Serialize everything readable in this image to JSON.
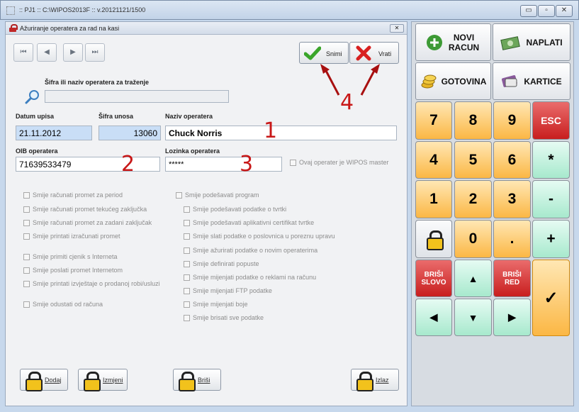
{
  "window": {
    "title": ":: PJ1 :: C:\\WIPOS2013F :: v.20121121/1500",
    "minimize": "▭",
    "maximize": "▫",
    "close": "✕"
  },
  "dialog": {
    "title": "Ažuriranje operatera za rad na kasi",
    "close": "✕"
  },
  "nav": {
    "first": "⏮",
    "prev": "◀",
    "next": "▶",
    "last": "⏭"
  },
  "toolbar": {
    "save_label": "Snimi",
    "back_label": "Vrati"
  },
  "search": {
    "label": "Šifra ili naziv operatera za traženje",
    "value": ""
  },
  "form": {
    "date_label": "Datum upisa",
    "date_value": "21.11.2012",
    "code_label": "Šifra unosa",
    "code_value": "13060",
    "name_label": "Naziv operatera",
    "name_value": "Chuck Norris",
    "oib_label": "OIB operatera",
    "oib_value": "71639533479",
    "password_label": "Lozinka operatera",
    "password_value": "*****",
    "master_label": "Ovaj operater je WIPOS master"
  },
  "annotations": {
    "n1": "1",
    "n2": "2",
    "n3": "3",
    "n4": "4"
  },
  "permissions_left": [
    "Smije računati promet za period",
    "Smije računati promet tekućeg zaključka",
    "Smije računati promet za zadani zaključak",
    "Smije printati izračunati promet",
    "Smije primiti cjenik s Interneta",
    "Smije poslati promet Internetom",
    "Smije printati izvještaje o prodanoj robi/usluzi",
    "Smije odustati od računa"
  ],
  "permissions_right": {
    "main": "Smije podešavati program",
    "sub": [
      "Smije podešavati podatke o tvrtki",
      "Smije podešavati aplikativni certifikat tvrtke",
      "Smije slati podatke o poslovnica u poreznu upravu",
      "Smije ažurirati podatke o novim operaterima",
      "Smije definirati popuste",
      "Smije mijenjati podatke o reklami na računu",
      "Smije mijenjati FTP podatke",
      "Smije mijenjati boje",
      "Smije brisati sve podatke"
    ]
  },
  "bottom": {
    "add": "Dodaj",
    "edit": "Izmjeni",
    "delete": "Briši",
    "exit": "Izlaz"
  },
  "panel": {
    "new_receipt": "NOVI RACUN",
    "pay": "NAPLATI",
    "cash": "GOTOVINA",
    "cards": "KARTICE",
    "keys": {
      "k7": "7",
      "k8": "8",
      "k9": "9",
      "esc": "ESC",
      "k4": "4",
      "k5": "5",
      "k6": "6",
      "mul": "*",
      "k1": "1",
      "k2": "2",
      "k3": "3",
      "minus": "-",
      "k0": "0",
      "dot": ".",
      "plus": "+",
      "del_char": "BRIŠI SLOVO",
      "del_row": "BRIŠI RED",
      "up": "▲",
      "down": "▼",
      "left": "◀",
      "right": "▶",
      "enter": "✓"
    }
  }
}
